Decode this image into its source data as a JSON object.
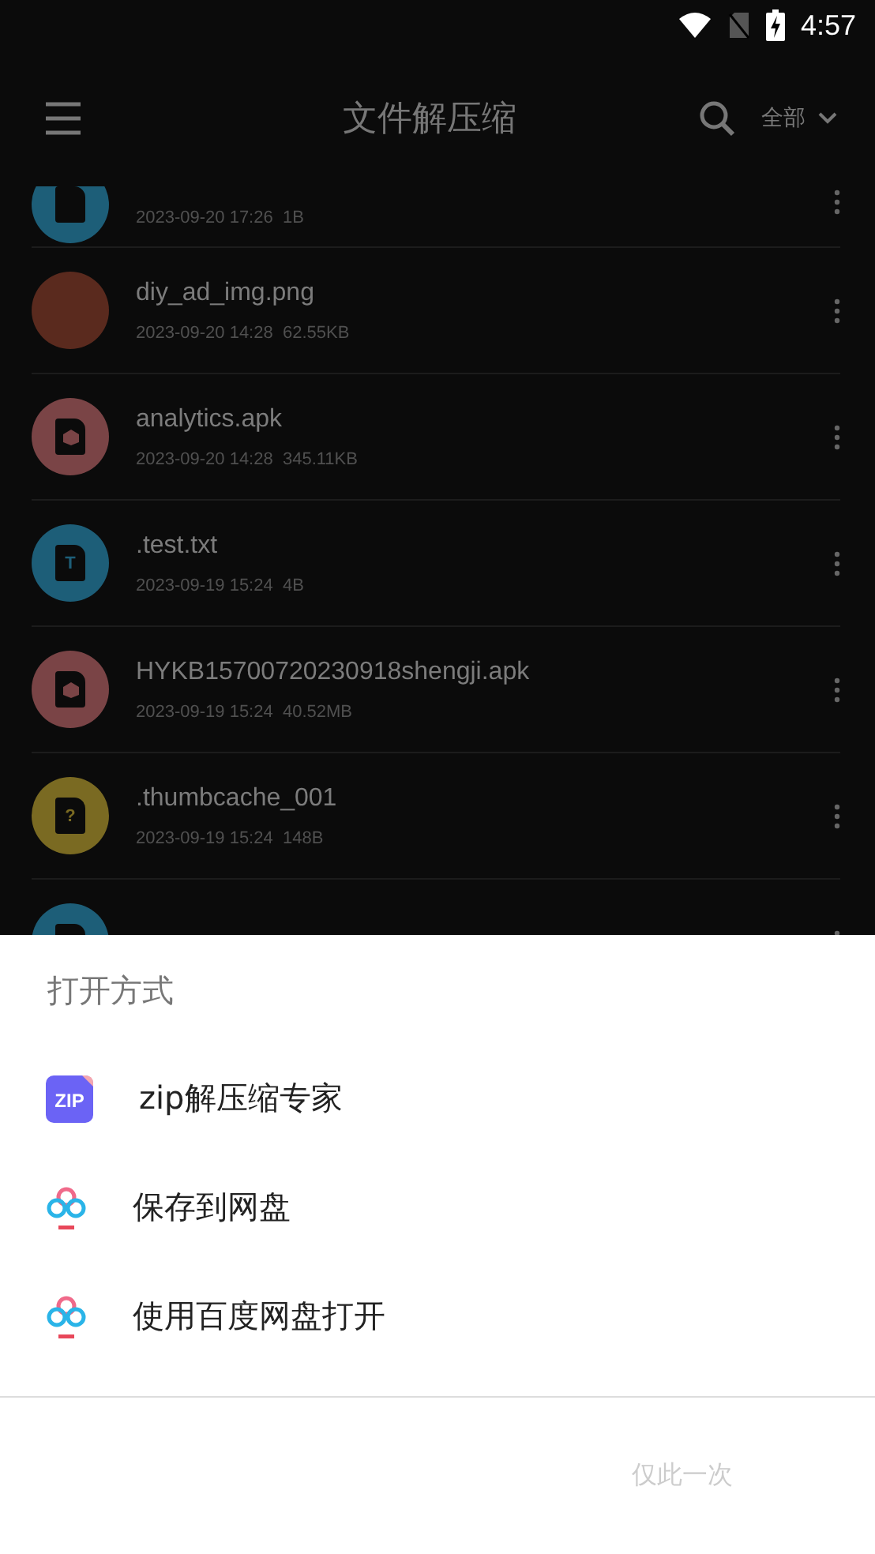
{
  "status_bar": {
    "time": "4:57"
  },
  "toolbar": {
    "title": "文件解压缩",
    "filter": "全部"
  },
  "files": [
    {
      "kind": "text",
      "color": "#1d5e78",
      "meta": "2023-09-20 17:26  1B"
    },
    {
      "kind": "image",
      "color": "#5a2a1e",
      "name": "diy_ad_img.png",
      "meta": "2023-09-20 14:28  62.55KB"
    },
    {
      "kind": "apk",
      "color": "#7a4446",
      "name": "analytics.apk",
      "meta": "2023-09-20 14:28  345.11KB"
    },
    {
      "kind": "text",
      "color": "#1d5e78",
      "glyph": "T",
      "name": ".test.txt",
      "meta": "2023-09-19 15:24  4B"
    },
    {
      "kind": "apk",
      "color": "#7a4446",
      "name": "HYKB15700720230918shengji.apk",
      "meta": "2023-09-19 15:24  40.52MB"
    },
    {
      "kind": "unknown",
      "color": "#7a6a22",
      "glyph": "?",
      "name": ".thumbcache_001",
      "meta": "2023-09-19 15:24  148B"
    },
    {
      "kind": "text",
      "color": "#1d5e78"
    }
  ],
  "sheet": {
    "title": "打开方式",
    "apps": [
      {
        "kind": "zip",
        "icon_text": "ZIP",
        "label": "zip解压缩专家"
      },
      {
        "kind": "cloud",
        "label": "保存到网盘"
      },
      {
        "kind": "cloud",
        "label": "使用百度网盘打开"
      }
    ],
    "buttons": [
      "仅此一次"
    ]
  }
}
